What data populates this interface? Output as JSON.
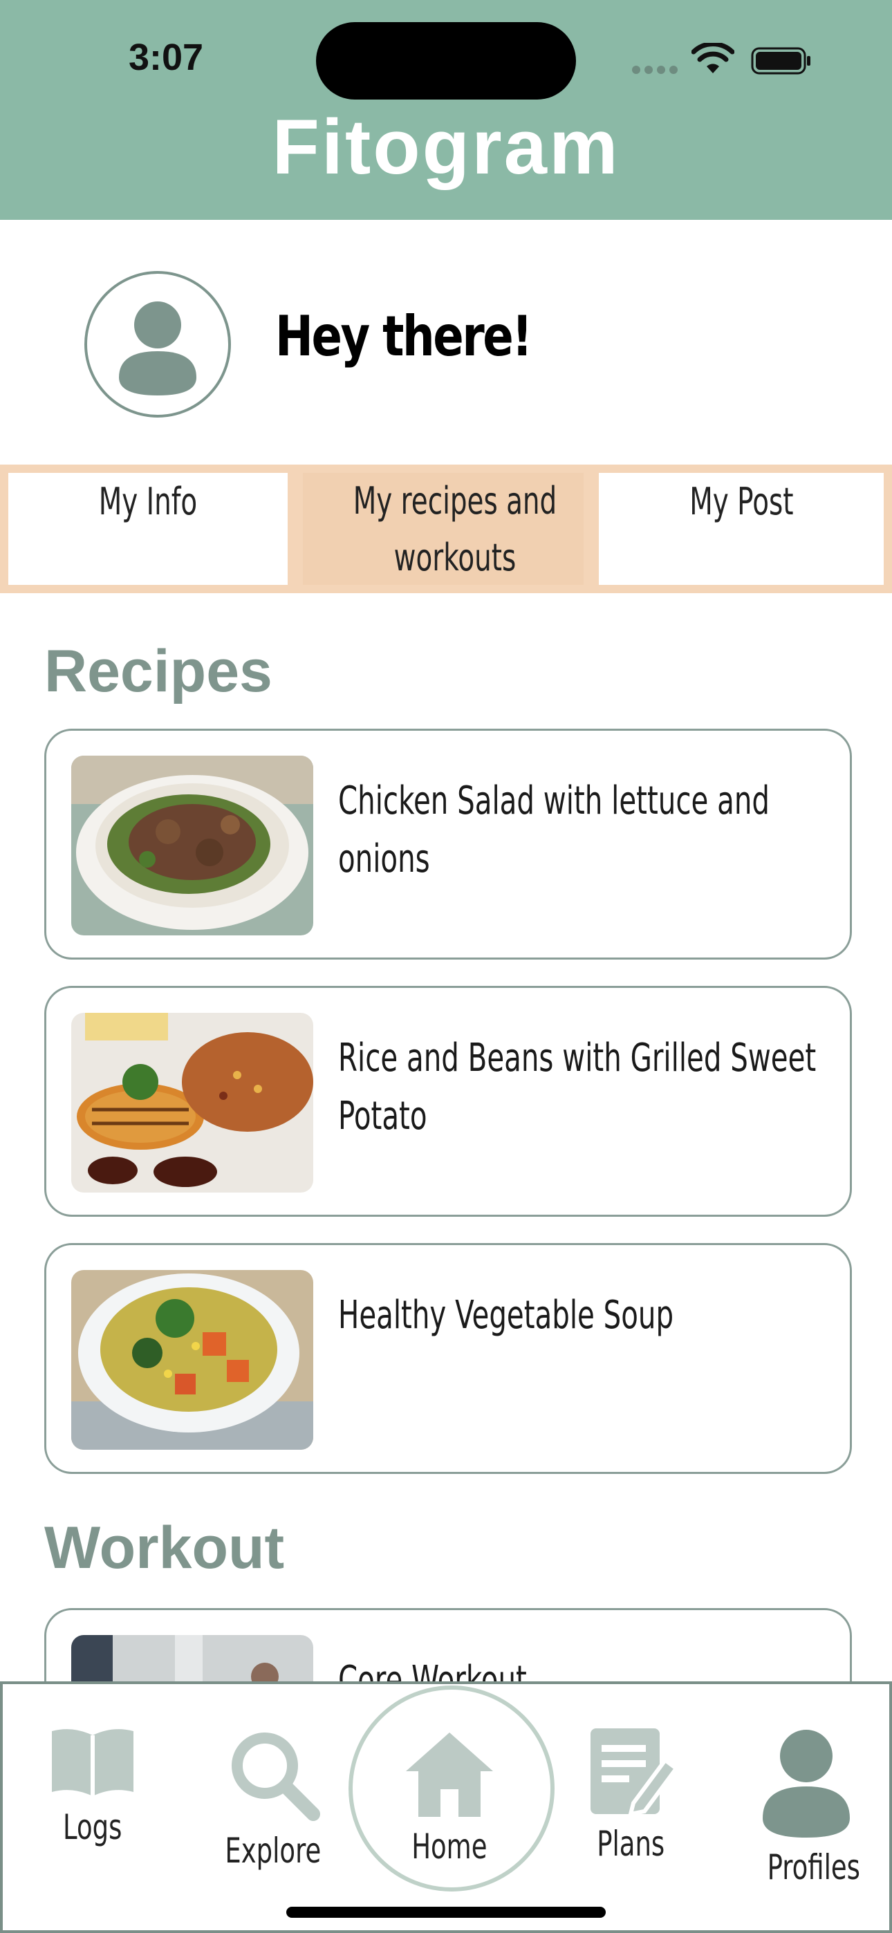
{
  "status_bar": {
    "time": "3:07"
  },
  "app": {
    "title": "Fitogram"
  },
  "profile": {
    "greeting": "Hey there!"
  },
  "tabs": [
    {
      "label": "My Info"
    },
    {
      "label": "My recipes and workouts"
    },
    {
      "label": "My Post"
    }
  ],
  "active_tab": "My recipes and workouts",
  "recipes": {
    "heading": "Recipes",
    "items": [
      {
        "title": "Chicken Salad with lettuce and onions"
      },
      {
        "title": "Rice and Beans with Grilled Sweet Potato"
      },
      {
        "title": "Healthy Vegetable Soup"
      }
    ]
  },
  "workout": {
    "heading": "Workout",
    "items": [
      {
        "title": "Core Workout"
      }
    ]
  },
  "nav": {
    "logs": "Logs",
    "explore": "Explore",
    "home": "Home",
    "plans": "Plans",
    "profiles": "Profiles"
  },
  "colors": {
    "header": "#8bb9a6",
    "tab_active": "#f1d0b1",
    "accent_text": "#7f958d",
    "icon": "#bccac5"
  }
}
